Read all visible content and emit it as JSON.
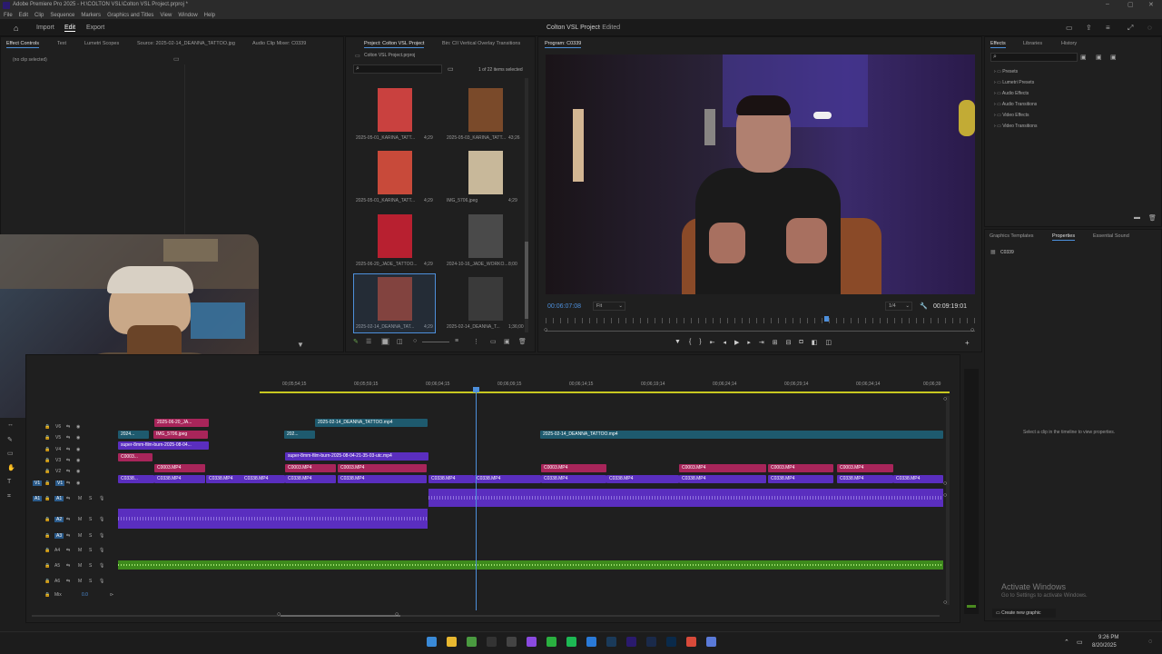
{
  "window": {
    "title": "Adobe Premiere Pro 2025 - H:\\COLTON VSL\\Colton VSL Project.prproj *"
  },
  "menu": [
    "File",
    "Edit",
    "Clip",
    "Sequence",
    "Markers",
    "Graphics and Titles",
    "View",
    "Window",
    "Help"
  ],
  "workspace": {
    "tabs": [
      "Import",
      "Edit",
      "Export"
    ],
    "active": "Edit",
    "project_title": "Colton VSL Project",
    "edited_label": "- Edited"
  },
  "source_panel": {
    "tabs": [
      "Effect Controls",
      "Text",
      "Lumetri Scopes",
      "Source: 2025-02-14_DEANNA_TATTOO.jpg",
      "Audio Clip Mixer: C0339"
    ],
    "empty_text": "(no clip selected)"
  },
  "project_panel": {
    "tabs": [
      "Project: Colton VSL Project",
      "Bin: CII Vertical Overlay Transitions"
    ],
    "file": "Colton VSL Project.prproj",
    "count": "1 of 22 items selected",
    "items": [
      {
        "name": "2025-05-01_KARINA_TATT...",
        "dur": "4;29",
        "color": "#c9413f"
      },
      {
        "name": "2025-05-03_KARINA_TATT...",
        "dur": "43;26",
        "color": "#7a4a2a"
      },
      {
        "name": "2025-05-01_KARINA_TATT...",
        "dur": "4;29",
        "color": "#c84a3a"
      },
      {
        "name": "IMG_5706.jpeg",
        "dur": "4;29",
        "color": "#c8b89a"
      },
      {
        "name": "2025-06-20_JADE_TATTOO...",
        "dur": "4;29",
        "color": "#b82030"
      },
      {
        "name": "2024-10-16_JADE_WORKO...",
        "dur": "8;00",
        "color": "#4a4a4a"
      },
      {
        "name": "2025-02-14_DEANNA_TAT...",
        "dur": "4;29",
        "color": "#8a3a2a"
      },
      {
        "name": "2025-02-14_DEANNA_T...",
        "dur": "1;36;00",
        "color": "#3a3a3a"
      }
    ]
  },
  "program": {
    "tab": "Program: C0339",
    "timecode": "00:06:07:08",
    "fit": "Fit",
    "quality": "1/4",
    "duration": "00:09:19:01"
  },
  "effects_panel": {
    "tabs": [
      "Effects",
      "Libraries",
      "History"
    ],
    "items": [
      "Presets",
      "Lumetri Presets",
      "Audio Effects",
      "Audio Transitions",
      "Video Effects",
      "Video Transitions"
    ]
  },
  "properties_panel": {
    "tabs": [
      "Graphics Templates",
      "Properties",
      "Essential Sound"
    ],
    "clip": "C0339",
    "message": "Select a clip in the timeline to view properties.",
    "button": "Create new graphic"
  },
  "timeline": {
    "ruler": [
      "00;05;54;15",
      "00;05;59;15",
      "00;06;04;15",
      "00;06;09;15",
      "00;06;14;15",
      "00;06;19;14",
      "00;06;24;14",
      "00;06;29;14",
      "00;06;34;14",
      "00;06;39"
    ],
    "video_tracks": [
      "V6",
      "V5",
      "V4",
      "V3",
      "V2",
      "V1"
    ],
    "audio_tracks": [
      "A1",
      "A2",
      "A3",
      "A4",
      "A5",
      "A6"
    ],
    "mix_label": "Mix",
    "mix_value": "0.0",
    "clips": {
      "v6a": "2025-06-20_JA...",
      "v6b": "2025-02-14_DEANNA_TATTOO.mp4",
      "v5a": "2024...",
      "v5b": "IMG_5706.jpeg",
      "v5c": "202...",
      "v5d": "2025-02-14_DEANNA_TATTOO.mp4",
      "v4a": "super-8mm-film-burn-2025-08-04...",
      "v4b": "super-8mm-film-burn-2025-08-04-21-35-03-utc.mp4",
      "v3a": "C0003...",
      "v2": "C0003.MP4",
      "v1a": "C0338...",
      "v1": "C0338.MP4"
    }
  },
  "webcam": {
    "visible": true
  },
  "watermark": {
    "line1": "Activate Windows",
    "line2": "Go to Settings to activate Windows."
  },
  "taskbar": {
    "time": "9:26 PM",
    "date": "8/20/2025"
  }
}
